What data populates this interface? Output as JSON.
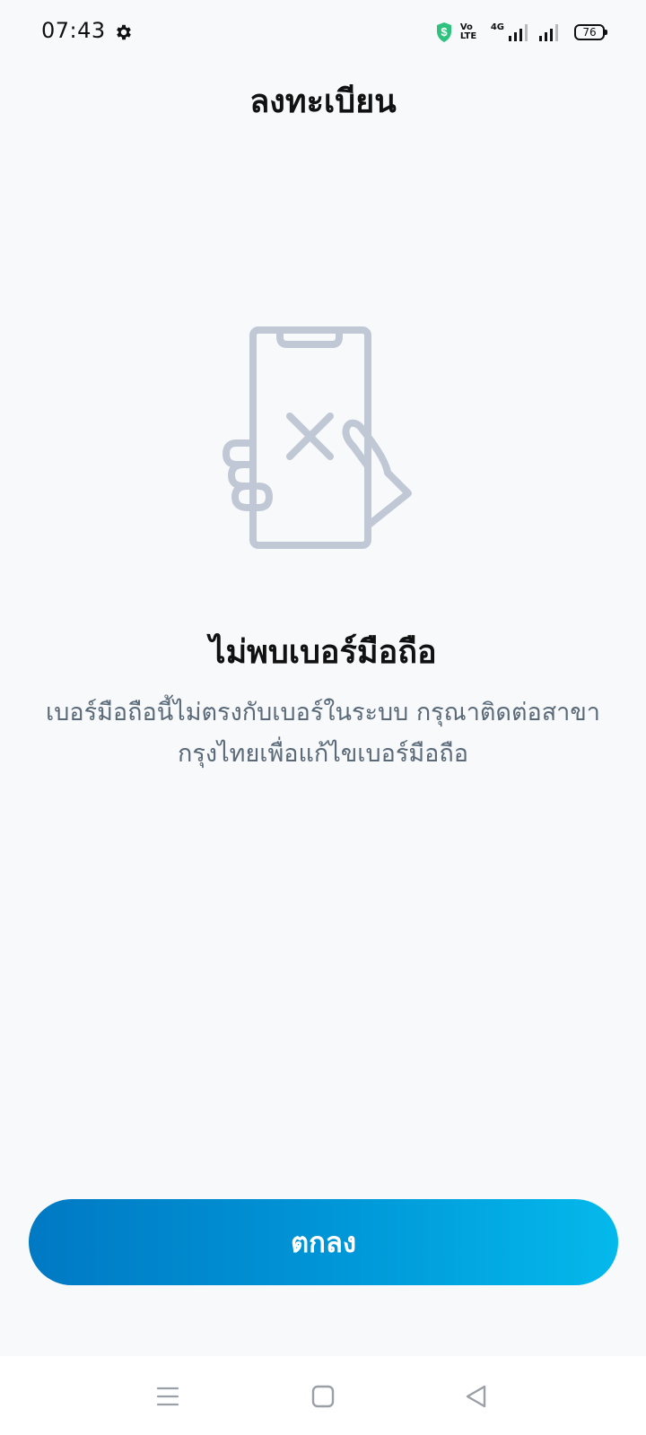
{
  "status_bar": {
    "time": "07:43",
    "volte_line1": "Vo",
    "volte_line2": "LTE",
    "network": "4G",
    "battery": "76"
  },
  "header": {
    "title": "ลงทะเบียน"
  },
  "illustration": {
    "icon": "phone-not-found-icon",
    "stroke_color": "#c1c8d5"
  },
  "error": {
    "title": "ไม่พบเบอร์มือถือ",
    "message": "เบอร์มือถือนี้ไม่ตรงกับเบอร์ในระบบ กรุณาติดต่อสาขากรุงไทยเพื่อแก้ไขเบอร์มือถือ"
  },
  "actions": {
    "ok_label": "ตกลง",
    "gradient_start": "#0079c3",
    "gradient_end": "#04b9ec"
  },
  "navigation": {
    "icons": [
      "menu-icon",
      "home-square-icon",
      "back-triangle-icon"
    ]
  }
}
